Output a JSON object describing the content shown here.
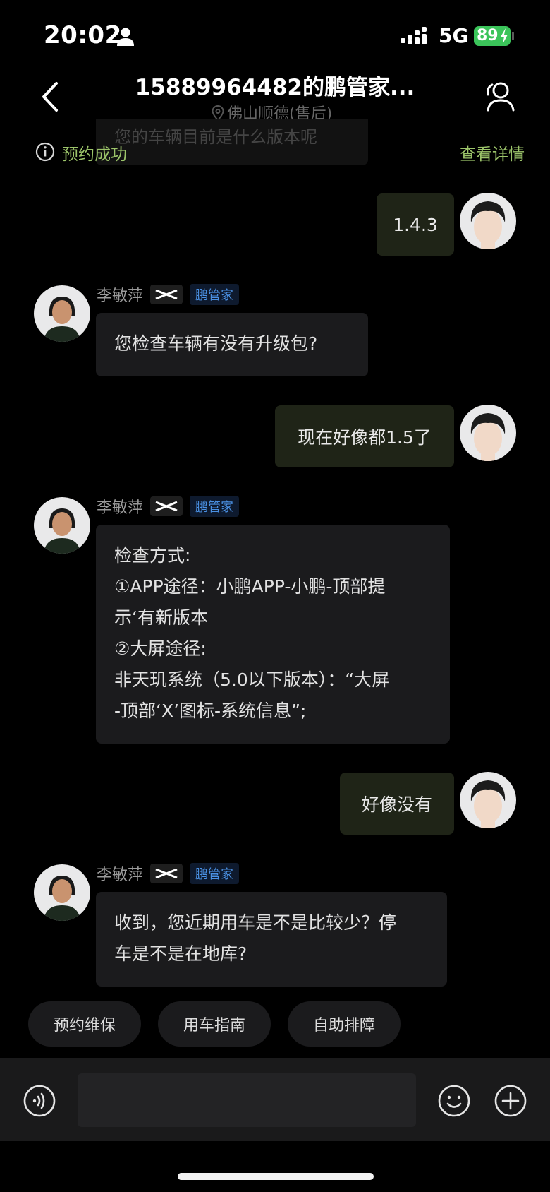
{
  "status_bar": {
    "time": "20:02",
    "network": "5G",
    "battery": "89"
  },
  "header": {
    "title": "15889964482的鹏管家...",
    "subtitle": "佛山顺德(售后)"
  },
  "ghost_message": "您的车辆目前是什么版本呢",
  "notice": {
    "text": "预约成功",
    "link": "查看详情"
  },
  "agent": {
    "name": "李敏萍",
    "role_badge": "鹏管家"
  },
  "messages": [
    {
      "from": "user",
      "lines": [
        "1.4.3"
      ]
    },
    {
      "from": "agent",
      "lines": [
        "您检查车辆有没有升级包?"
      ]
    },
    {
      "from": "user",
      "lines": [
        "现在好像都1.5了"
      ]
    },
    {
      "from": "agent",
      "lines": [
        "检查方式:",
        "①APP途径：小鹏APP-小鹏-顶部提",
        "示‘有新版本",
        "②大屏途径:",
        "非天玑系统（5.0以下版本）：“大屏",
        "-顶部‘X’图标-系统信息”;"
      ]
    },
    {
      "from": "user",
      "lines": [
        "好像没有"
      ]
    },
    {
      "from": "agent",
      "lines": [
        "收到，您近期用车是不是比较少？停",
        "车是不是在地库?"
      ]
    }
  ],
  "quick_actions": [
    "预约维保",
    "用车指南",
    "自助排障"
  ],
  "input": {
    "placeholder": ""
  },
  "colors": {
    "accent_green": "#9cc46a",
    "user_bubble": "#1f2417",
    "agent_bubble": "#1b1b1d",
    "badge_blue": "#4a90e2",
    "battery_green": "#3bc45a"
  }
}
